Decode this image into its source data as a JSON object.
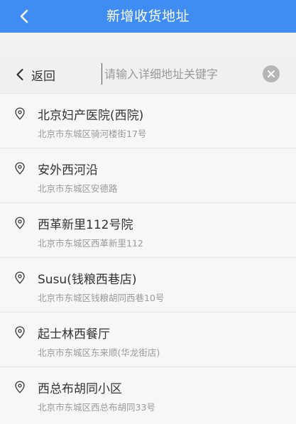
{
  "header": {
    "title": "新增收货地址",
    "back_icon": "chevron-left-icon",
    "background": "#3f8df2"
  },
  "search": {
    "back_label": "返回",
    "placeholder": "请输入详细地址关键字",
    "value": "",
    "clear_icon": "clear-circle-icon"
  },
  "results": [
    {
      "name": "北京妇产医院(西院)",
      "address": "北京市东城区骑河楼街17号"
    },
    {
      "name": "安外西河沿",
      "address": "北京市东城区安德路"
    },
    {
      "name": "西革新里112号院",
      "address": "北京市东城区西革新里112"
    },
    {
      "name": "Susu(钱粮西巷店)",
      "address": "北京市东城区钱粮胡同西巷10号"
    },
    {
      "name": "起士林西餐厅",
      "address": "北京市东城区东来顺(华龙街店)"
    },
    {
      "name": "西总布胡同小区",
      "address": "北京市东城区西总布胡同33号"
    }
  ]
}
